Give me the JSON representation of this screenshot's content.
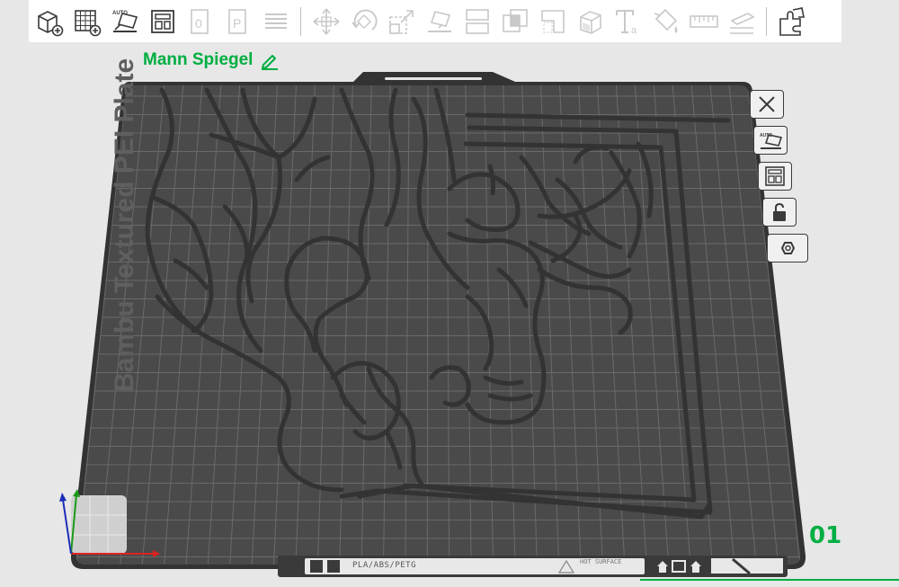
{
  "toolbar": {
    "items": [
      {
        "name": "add-object-button",
        "icon": "add-cube-icon",
        "enabled": true
      },
      {
        "name": "add-plate-button",
        "icon": "add-plate-grid-icon",
        "enabled": true
      },
      {
        "name": "auto-orient-button",
        "icon": "auto-orient-icon",
        "label": "AUTO",
        "enabled": true
      },
      {
        "name": "arrange-button",
        "icon": "arrange-icon",
        "enabled": true
      },
      {
        "name": "orient-0-button",
        "icon": "orient-zero-icon",
        "enabled": false
      },
      {
        "name": "plate-p-button",
        "icon": "plate-p-icon",
        "enabled": false
      },
      {
        "name": "layers-button",
        "icon": "layers-icon",
        "enabled": false
      },
      {
        "name": "move-button",
        "icon": "move-icon",
        "enabled": false
      },
      {
        "name": "rotate-button",
        "icon": "rotate-icon",
        "enabled": false
      },
      {
        "name": "scale-button",
        "icon": "scale-icon",
        "enabled": false
      },
      {
        "name": "lay-on-face-button",
        "icon": "lay-on-face-icon",
        "enabled": false
      },
      {
        "name": "cut-button",
        "icon": "cut-icon",
        "enabled": false
      },
      {
        "name": "boolean-button",
        "icon": "boolean-icon",
        "enabled": false
      },
      {
        "name": "support-paint-button",
        "icon": "support-paint-icon",
        "enabled": false
      },
      {
        "name": "seam-paint-button",
        "icon": "seam-paint-icon",
        "enabled": false
      },
      {
        "name": "text-button",
        "icon": "text-icon",
        "enabled": false
      },
      {
        "name": "color-paint-button",
        "icon": "color-paint-icon",
        "enabled": false
      },
      {
        "name": "measure-button",
        "icon": "measure-icon",
        "enabled": false
      },
      {
        "name": "assembly-button",
        "icon": "assembly-icon",
        "enabled": false
      },
      {
        "name": "explode-button",
        "icon": "explode-puzzle-icon",
        "enabled": true
      }
    ]
  },
  "plate": {
    "name": "Mann Spiegel",
    "number": "01",
    "bed_text": "Bambu Textured PEI Plate",
    "filament_types": "PLA/ABS/PETG",
    "hot_surface": "HOT SURFACE"
  },
  "side_tools": [
    {
      "name": "delete-plate-button",
      "icon": "close-icon"
    },
    {
      "name": "auto-orient-plate-button",
      "icon": "auto-orient-icon"
    },
    {
      "name": "arrange-plate-button",
      "icon": "arrange-icon"
    },
    {
      "name": "lock-plate-button",
      "icon": "unlock-icon"
    },
    {
      "name": "plate-settings-button",
      "icon": "hexagon-settings-icon"
    }
  ],
  "colors": {
    "accent": "#00ae42",
    "bed": "#4a4a4a",
    "bed_dark": "#333333",
    "grid": "#6a6a6a",
    "model": "#3c3c3c",
    "icon_active": "#3a3a3a",
    "icon_disabled": "#c8c8c8",
    "background": "#e6e7e6"
  }
}
